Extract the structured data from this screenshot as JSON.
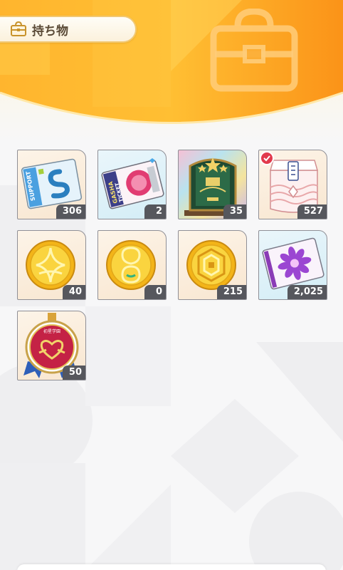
{
  "header": {
    "title": "持ち物",
    "title_icon": "bag-icon",
    "decor_icon": "bag-icon",
    "colors": {
      "orange": "#f9a21b",
      "light": "#fff1c8",
      "accent": "#f2c872"
    }
  },
  "items": [
    {
      "name": "support-ticket",
      "icon": "support-card-icon",
      "count": "306"
    },
    {
      "name": "gacha-ticket",
      "icon": "gacha-ticket-icon",
      "count": "2"
    },
    {
      "name": "gate-trophy",
      "icon": "gate-icon",
      "count": "35"
    },
    {
      "name": "gift-box",
      "icon": "gift-box-icon",
      "count": "527"
    },
    {
      "name": "star-coin",
      "icon": "star-coin-icon",
      "count": "40"
    },
    {
      "name": "loop-coin",
      "icon": "loop-coin-icon",
      "count": "0"
    },
    {
      "name": "hex-coin",
      "icon": "hex-coin-icon",
      "count": "215"
    },
    {
      "name": "flower-card",
      "icon": "flower-card-icon",
      "count": "2,025"
    },
    {
      "name": "medal",
      "icon": "medal-icon",
      "count": "50"
    }
  ]
}
